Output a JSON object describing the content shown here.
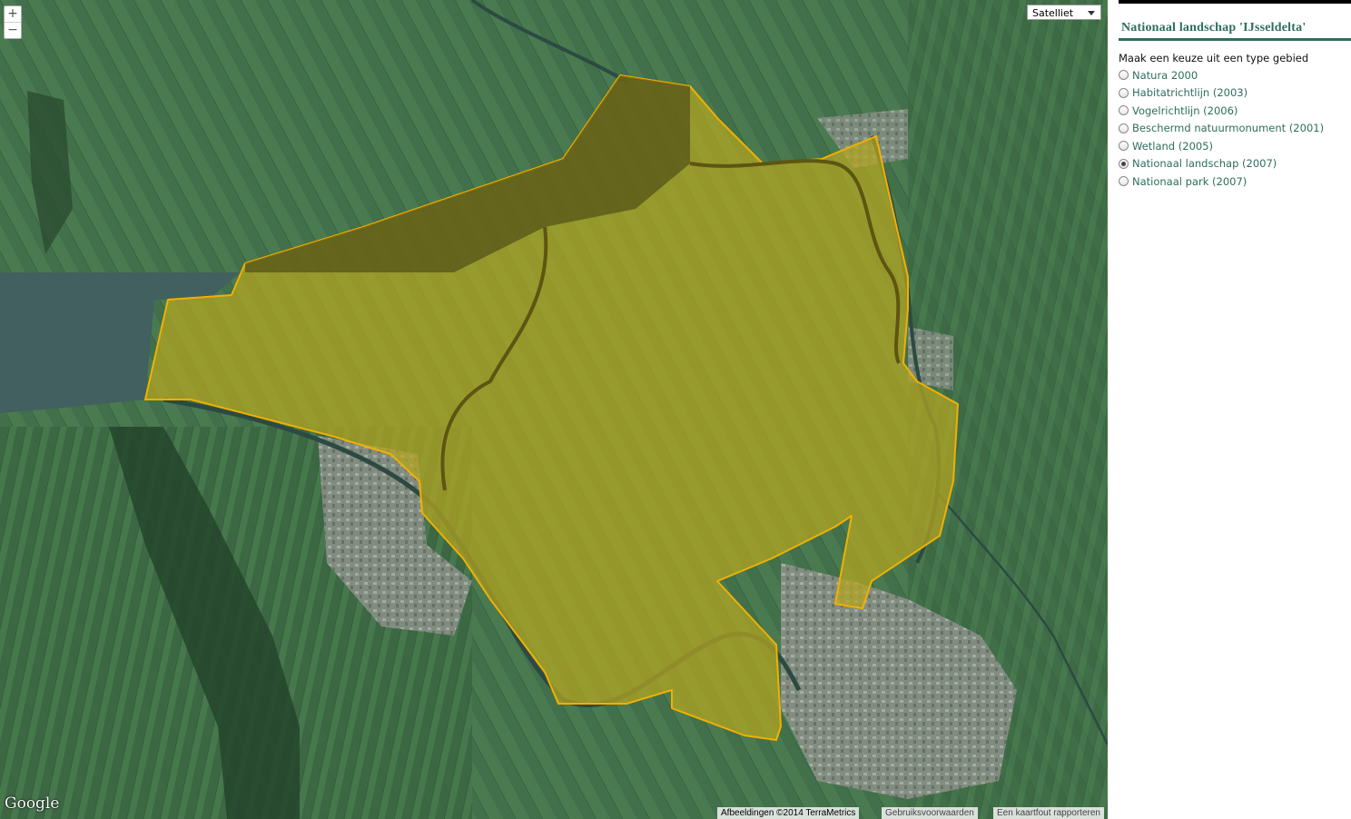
{
  "map": {
    "zoom_in_label": "+",
    "zoom_out_label": "−",
    "map_type": "Satelliet",
    "logo_text": "Google",
    "attribution": {
      "imagery": "Afbeeldingen ©2014 TerraMetrics",
      "terms": "Gebruiksvoorwaarden",
      "report": "Een kaartfout rapporteren"
    },
    "colors": {
      "land": "#3f6d45",
      "water": "#41605f",
      "urban": "#8a8d86",
      "polygon_fill": "#b3a51f",
      "polygon_stroke": "#f2b000"
    }
  },
  "panel": {
    "title": "Nationaal landschap 'IJsseldelta'",
    "intro": "Maak een keuze uit een type gebied",
    "accent_color": "#2e6e5c",
    "options": [
      {
        "label": "Natura 2000",
        "checked": false
      },
      {
        "label": "Habitatrichtlijn (2003)",
        "checked": false
      },
      {
        "label": "Vogelrichtlijn (2006)",
        "checked": false
      },
      {
        "label": "Beschermd natuurmonument (2001)",
        "checked": false
      },
      {
        "label": "Wetland (2005)",
        "checked": false
      },
      {
        "label": "Nationaal landschap (2007)",
        "checked": true
      },
      {
        "label": "Nationaal park (2007)",
        "checked": false
      }
    ]
  }
}
